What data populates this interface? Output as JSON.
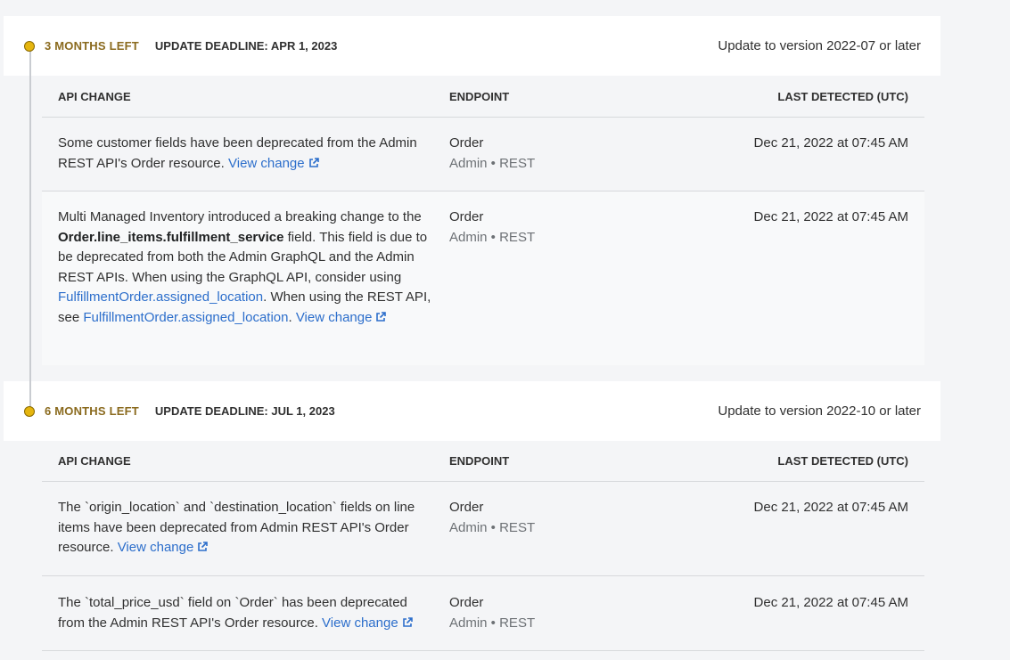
{
  "sections": [
    {
      "months_left": "3 MONTHS LEFT",
      "deadline": "UPDATE DEADLINE: APR 1, 2023",
      "update_version": "Update to version 2022-07 or later",
      "headers": {
        "change": "API CHANGE",
        "endpoint": "ENDPOINT",
        "detected": "LAST DETECTED (UTC)"
      },
      "rows": [
        {
          "text": "Some customer fields have been deprecated from the Admin REST API's Order resource.",
          "link": "View change",
          "endpoint": "Order",
          "endpoint_sub": "Admin • REST",
          "detected": "Dec 21, 2022 at 07:45 AM"
        },
        {
          "text_1": "Multi Managed Inventory introduced a breaking change to the",
          "code": "Order.line_items.fulfillment_service",
          "text_2": "field. This field is due to be deprecated from both the Admin GraphQL and the Admin REST APIs. When using the GraphQL API, consider using",
          "link_1": "FulfillmentOrder.assigned_location",
          "text_3": ". When using the REST API, see",
          "link_2": "FulfillmentOrder.assigned_location",
          "text_4": ".",
          "link": "View change",
          "endpoint": "Order",
          "endpoint_sub": "Admin • REST",
          "detected": "Dec 21, 2022 at 07:45 AM"
        }
      ]
    },
    {
      "months_left": "6 MONTHS LEFT",
      "deadline": "UPDATE DEADLINE: JUL 1, 2023",
      "update_version": "Update to version 2022-10 or later",
      "headers": {
        "change": "API CHANGE",
        "endpoint": "ENDPOINT",
        "detected": "LAST DETECTED (UTC)"
      },
      "rows": [
        {
          "text": "The `origin_location` and `destination_location` fields on line items have been deprecated from Admin REST API's Order resource.",
          "link": "View change",
          "endpoint": "Order",
          "endpoint_sub": "Admin • REST",
          "detected": "Dec 21, 2022 at 07:45 AM"
        },
        {
          "text": "The `total_price_usd` field on `Order` has been deprecated from the Admin REST API's Order resource.",
          "link": "View change",
          "endpoint": "Order",
          "endpoint_sub": "Admin • REST",
          "detected": "Dec 21, 2022 at 07:45 AM"
        }
      ]
    }
  ],
  "colors": {
    "dot": "#e5b50e",
    "link": "#2c6ecb",
    "months_left": "#8a6a1e"
  },
  "icons": {
    "timeline_dot": "warning-dot-icon",
    "external": "external-link-icon"
  }
}
